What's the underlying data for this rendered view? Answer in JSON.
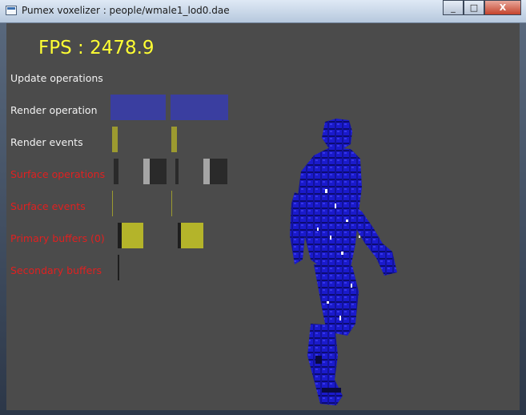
{
  "window": {
    "title": "Pumex voxelizer : people/wmale1_lod0.dae",
    "controls": {
      "minimize": "_",
      "maximize": "□",
      "close": "X"
    }
  },
  "overlay": {
    "fps_text": "FPS : 2478.9",
    "rows": [
      {
        "label": "Update operations",
        "color": "#f2f2f2"
      },
      {
        "label": "Render operation",
        "color": "#f2f2f2"
      },
      {
        "label": "Render events",
        "color": "#f2f2f2"
      },
      {
        "label": "Surface operations",
        "color": "#e02020"
      },
      {
        "label": "Surface events",
        "color": "#e02020"
      },
      {
        "label": "Primary buffers (0)",
        "color": "#e02020"
      },
      {
        "label": "Secondary buffers",
        "color": "#e02020"
      }
    ]
  },
  "colors": {
    "viewport_bg": "#4b4b4b",
    "fps": "#ffff33",
    "render_operation": "#3a3ea0",
    "render_event": "#9c9a30",
    "surface_op_light": "#a5a5a5",
    "surface_op_dark": "#2a2a2a",
    "primary_buffer": "#b4b42a",
    "voxel_blue": "#1a1acc"
  }
}
